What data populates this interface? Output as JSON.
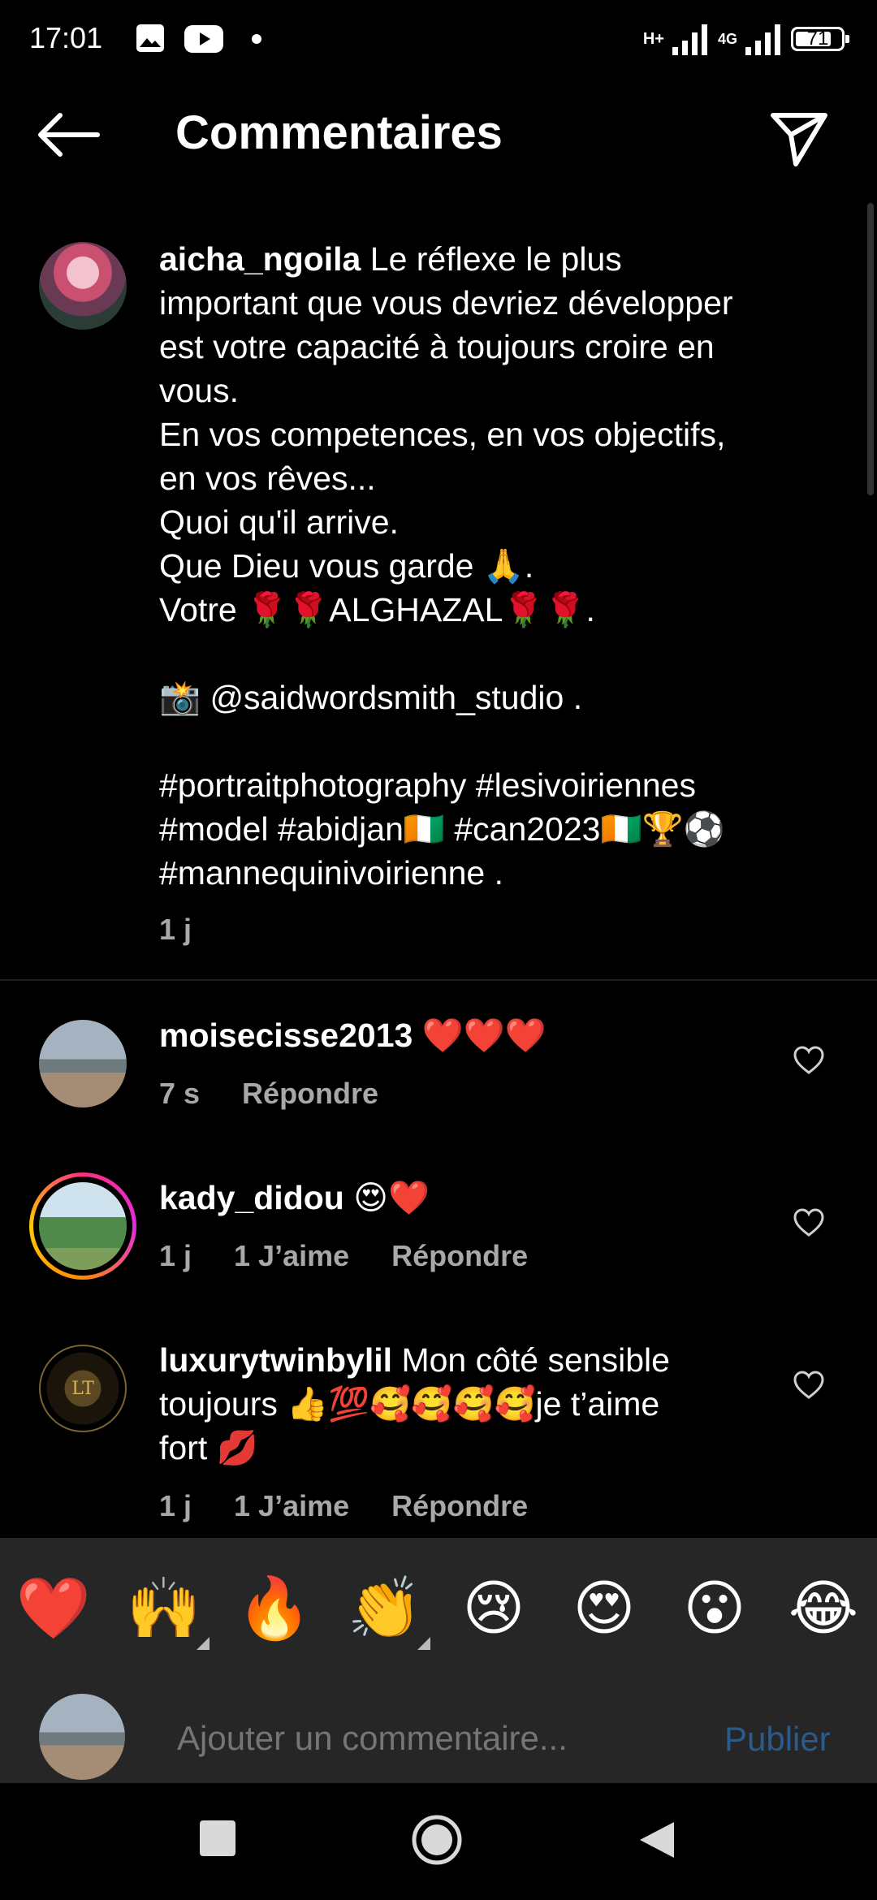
{
  "status_bar": {
    "time": "17:01",
    "network_type": "H+",
    "network_type_2": "4G",
    "battery": "71",
    "icons": [
      "gallery-icon",
      "youtube-icon",
      "dot-icon"
    ]
  },
  "header": {
    "title": "Commentaires"
  },
  "caption": {
    "username": "aicha_ngoila",
    "lines": [
      "Le réflexe le plus",
      "important que vous devriez développer",
      "est votre capacité à toujours croire en",
      "vous.",
      "En vos competences, en vos objectifs,",
      "en vos rêves...",
      "Quoi qu'il arrive.",
      "Que Dieu vous garde 🙏.",
      "Votre 🌹🌹ALGHAZAL🌹🌹.",
      "",
      "📸 @saidwordsmith_studio .",
      "",
      "#portraitphotography #lesivoiriennes",
      "#model #abidjan🇨🇮 #can2023🇨🇮🏆⚽",
      "#mannequinivoirienne ."
    ],
    "time": "1 j"
  },
  "comments": [
    {
      "username": "moisecisse2013",
      "text": "❤️❤️❤️",
      "time": "7 s",
      "likes": "",
      "reply": "Répondre"
    },
    {
      "username": "kady_didou",
      "text": "😍❤️",
      "time": "1 j",
      "likes": "1 J’aime",
      "reply": "Répondre"
    },
    {
      "username": "luxurytwinbylil",
      "text_lines": [
        "Mon côté sensible",
        "toujours 👍💯🥰🥰🥰🥰je t’aime",
        "fort 💋"
      ],
      "time": "1 j",
      "likes": "1 J’aime",
      "reply": "Répondre"
    }
  ],
  "emoji_bar": [
    "❤️",
    "🙌",
    "🔥",
    "👏",
    "😢",
    "😍",
    "😮",
    "😂"
  ],
  "composer": {
    "placeholder": "Ajouter un commentaire...",
    "post_label": "Publier"
  },
  "colors": {
    "background": "#000000",
    "secondary_text": "#a8a8a8",
    "post_disabled": "#2a5b8a",
    "emoji_bar_bg": "#262626"
  }
}
